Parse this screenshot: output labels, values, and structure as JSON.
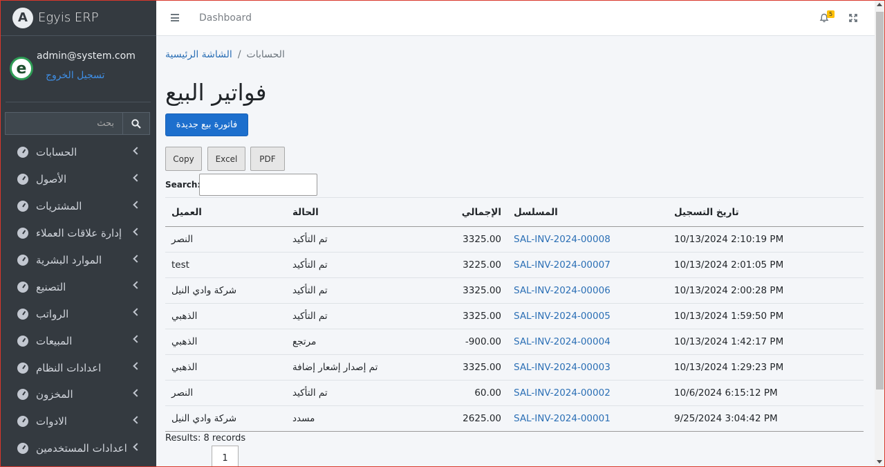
{
  "brand": {
    "name": "Egyis ERP",
    "logo_letter": "A"
  },
  "user": {
    "email": "admin@system.com",
    "logout": "تسجيل الخروج",
    "avatar_letter": "e"
  },
  "sidebar_search": {
    "placeholder": "بحث"
  },
  "nav": [
    {
      "label": "الحسابات"
    },
    {
      "label": "الأصول"
    },
    {
      "label": "المشتريات"
    },
    {
      "label": "إدارة علاقات العملاء"
    },
    {
      "label": "الموارد البشرية"
    },
    {
      "label": "التصنيع"
    },
    {
      "label": "الرواتب"
    },
    {
      "label": "المبيعات"
    },
    {
      "label": "اعدادات النظام"
    },
    {
      "label": "المخزون"
    },
    {
      "label": "الادوات"
    },
    {
      "label": "اعدادات المستخدمين"
    }
  ],
  "topbar": {
    "breadcrumb": "Dashboard",
    "notification_count": "5"
  },
  "breadcrumb": {
    "home": "الشاشة الرئيسية",
    "current": "الحسابات",
    "separator": "/"
  },
  "page": {
    "title": "فواتير البيع",
    "new_button": "فاتورة بيع جديدة",
    "export": {
      "copy": "Copy",
      "excel": "Excel",
      "pdf": "PDF"
    },
    "search_label": "Search:",
    "search_value": ""
  },
  "table": {
    "headers": {
      "client": "العميل",
      "status": "الحالة",
      "total": "الإجمالي",
      "serial": "المسلسل",
      "date": "تاريخ التسجيل"
    },
    "rows": [
      {
        "client": "النصر",
        "status": "تم التأكيد",
        "total": "3325.00",
        "serial": "SAL-INV-2024-00008",
        "date": "10/13/2024 2:10:19 PM"
      },
      {
        "client": "test",
        "status": "تم التأكيد",
        "total": "3225.00",
        "serial": "SAL-INV-2024-00007",
        "date": "10/13/2024 2:01:05 PM"
      },
      {
        "client": "شركة وادي النيل",
        "status": "تم التأكيد",
        "total": "3325.00",
        "serial": "SAL-INV-2024-00006",
        "date": "10/13/2024 2:00:28 PM"
      },
      {
        "client": "الذهبي",
        "status": "تم التأكيد",
        "total": "3325.00",
        "serial": "SAL-INV-2024-00005",
        "date": "10/13/2024 1:59:50 PM"
      },
      {
        "client": "الذهبي",
        "status": "مرتجع",
        "total": "-900.00",
        "serial": "SAL-INV-2024-00004",
        "date": "10/13/2024 1:42:17 PM"
      },
      {
        "client": "الذهبي",
        "status": "تم إصدار إشعار إضافة",
        "total": "3325.00",
        "serial": "SAL-INV-2024-00003",
        "date": "10/13/2024 1:29:23 PM"
      },
      {
        "client": "النصر",
        "status": "تم التأكيد",
        "total": "60.00",
        "serial": "SAL-INV-2024-00002",
        "date": "10/6/2024 6:15:12 PM"
      },
      {
        "client": "شركة وادي النيل",
        "status": "مسدد",
        "total": "2625.00",
        "serial": "SAL-INV-2024-00001",
        "date": "9/25/2024 3:04:42 PM"
      }
    ]
  },
  "footer": {
    "results": "Results: 8 records",
    "page": "1"
  },
  "colors": {
    "sidebar": "#343a40",
    "primary": "#1d6fcd",
    "link": "#2b6fb5"
  }
}
